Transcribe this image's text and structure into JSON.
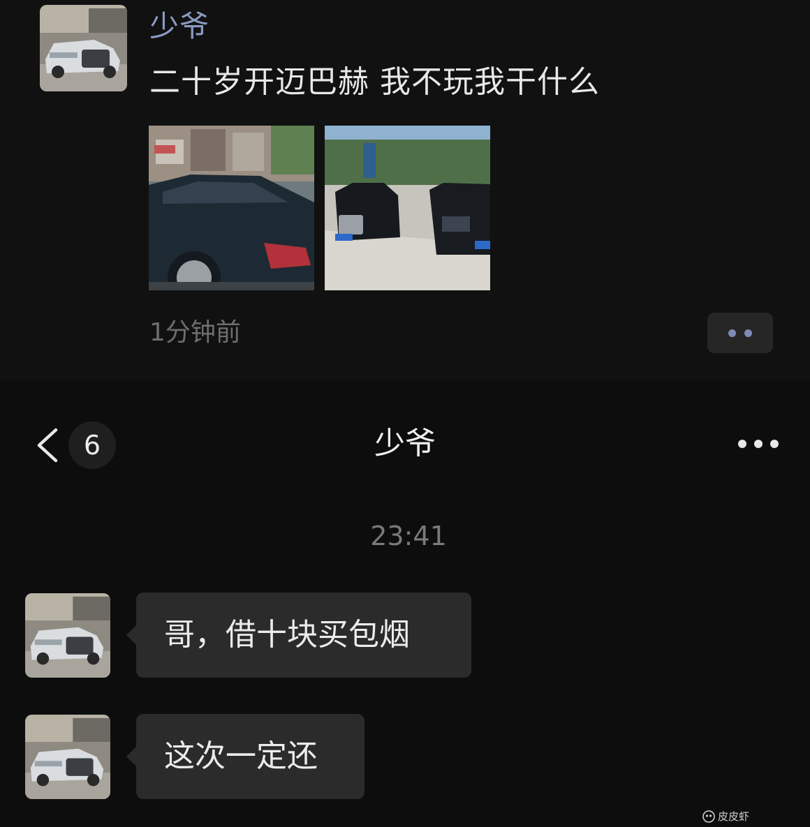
{
  "moment": {
    "author": "少爷",
    "text": "二十岁开迈巴赫 我不玩我干什么",
    "time": "1分钟前",
    "photos": [
      "maybach-side-photo",
      "maybach-parking-photo"
    ],
    "more_icon": "more-dots-icon"
  },
  "chat": {
    "back_icon": "chevron-left-icon",
    "unread_count": "6",
    "title": "少爷",
    "more_icon": "ellipsis-icon",
    "timestamp": "23:41",
    "messages": [
      {
        "text": "哥，借十块买包烟"
      },
      {
        "text": "这次一定还"
      }
    ]
  },
  "watermark": {
    "text": "皮皮虾"
  },
  "colors": {
    "background": "#0d0d0d",
    "author_name": "#8a9bc4",
    "bubble": "#2b2b2b"
  }
}
